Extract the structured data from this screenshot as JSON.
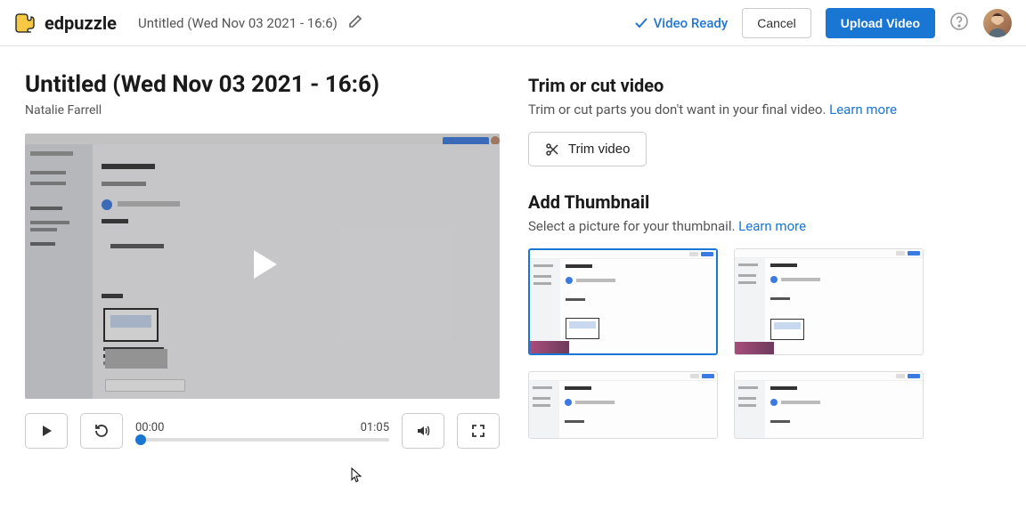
{
  "brand": "edpuzzle",
  "header": {
    "title": "Untitled (Wed Nov 03 2021 - 16:6)",
    "video_ready": "Video Ready",
    "cancel": "Cancel",
    "upload": "Upload Video"
  },
  "page": {
    "title": "Untitled (Wed Nov 03 2021 - 16:6)",
    "author": "Natalie Farrell"
  },
  "player": {
    "current_time": "00:00",
    "duration": "01:05"
  },
  "trim": {
    "heading": "Trim or cut video",
    "desc": "Trim or cut parts you don't want in your final video. ",
    "learn_more": "Learn more",
    "button": "Trim video"
  },
  "thumbnail": {
    "heading": "Add Thumbnail",
    "desc": "Select a picture for your thumbnail. ",
    "learn_more": "Learn more"
  }
}
